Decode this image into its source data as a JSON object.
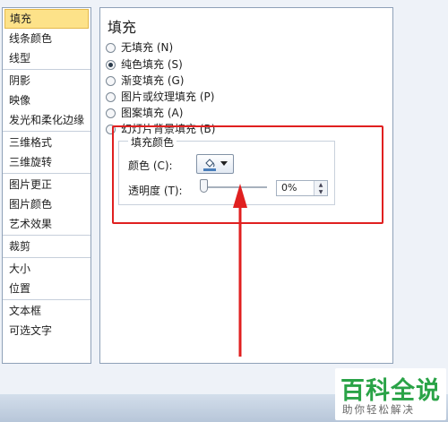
{
  "sidebar": {
    "groups": [
      [
        "填充",
        "线条颜色",
        "线型"
      ],
      [
        "阴影",
        "映像",
        "发光和柔化边缘"
      ],
      [
        "三维格式",
        "三维旋转"
      ],
      [
        "图片更正",
        "图片颜色",
        "艺术效果"
      ],
      [
        "裁剪"
      ],
      [
        "大小",
        "位置"
      ],
      [
        "文本框",
        "可选文字"
      ]
    ],
    "selected": "填充"
  },
  "content": {
    "title": "填充",
    "radios": [
      {
        "label": "无填充 (N)",
        "checked": false
      },
      {
        "label": "纯色填充 (S)",
        "checked": true
      },
      {
        "label": "渐变填充 (G)",
        "checked": false
      },
      {
        "label": "图片或纹理填充 (P)",
        "checked": false
      },
      {
        "label": "图案填充 (A)",
        "checked": false
      },
      {
        "label": "幻灯片背景填充 (B)",
        "checked": false
      }
    ],
    "fill_color": {
      "legend": "填充颜色",
      "color_label": "颜色 (C):",
      "transparency_label": "透明度 (T):",
      "transparency_value": "0%",
      "transparency_fraction": 0
    }
  },
  "watermark": {
    "brand": "百科全说",
    "slogan": "助你轻松解决"
  },
  "colors": {
    "highlight": "#e02020",
    "selected_bg": "#fde289",
    "brand_green": "#2aa347"
  }
}
